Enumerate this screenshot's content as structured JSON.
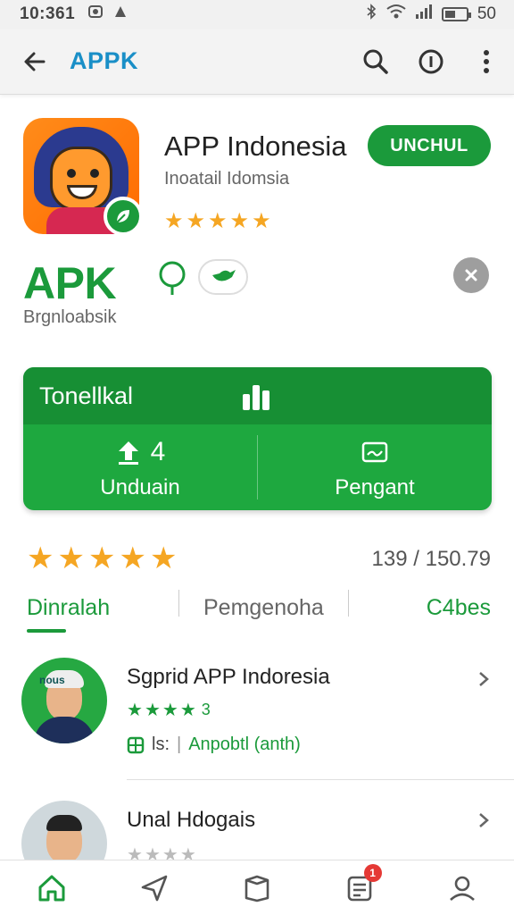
{
  "status_bar": {
    "time": "10:361",
    "battery_text": "50",
    "battery_level": 0.5
  },
  "app_bar": {
    "title": "APPK",
    "icons": [
      "back-arrow-icon",
      "search-icon",
      "info-icon",
      "more-vert-icon"
    ]
  },
  "app": {
    "name": "APP Indonesia",
    "developer": "Inoatail Idomsia",
    "rating_stars": 5,
    "install_label": "UNCHUL"
  },
  "brand": {
    "title": "APK",
    "subtitle": "Brgnloabsik"
  },
  "card": {
    "title": "Tonellkal",
    "left_value": "4",
    "left_label": "Unduain",
    "right_label": "Pengant"
  },
  "rating": {
    "stars": 5,
    "count": "139 / 150.79"
  },
  "tabs": [
    {
      "label": "Dinralah"
    },
    {
      "label": "Pemgenoha"
    },
    {
      "label": "C4bes"
    }
  ],
  "list": [
    {
      "title": "Sgprid APP Indoresia",
      "stars": 4,
      "rating_text": "3",
      "meta_left": "ls:",
      "meta_right": "Anpobtl (anth)",
      "avatar_label": "nous"
    },
    {
      "title": "Unal Hdogais",
      "stars": 4,
      "rating_text": ""
    }
  ],
  "bottom_nav": {
    "items": [
      "home-icon",
      "explore-icon",
      "library-icon",
      "news-icon",
      "profile-icon"
    ],
    "badge": "1"
  },
  "colors": {
    "green": "#1b9a3b",
    "title_blue": "#1a8fc7",
    "star": "#f5a623"
  }
}
